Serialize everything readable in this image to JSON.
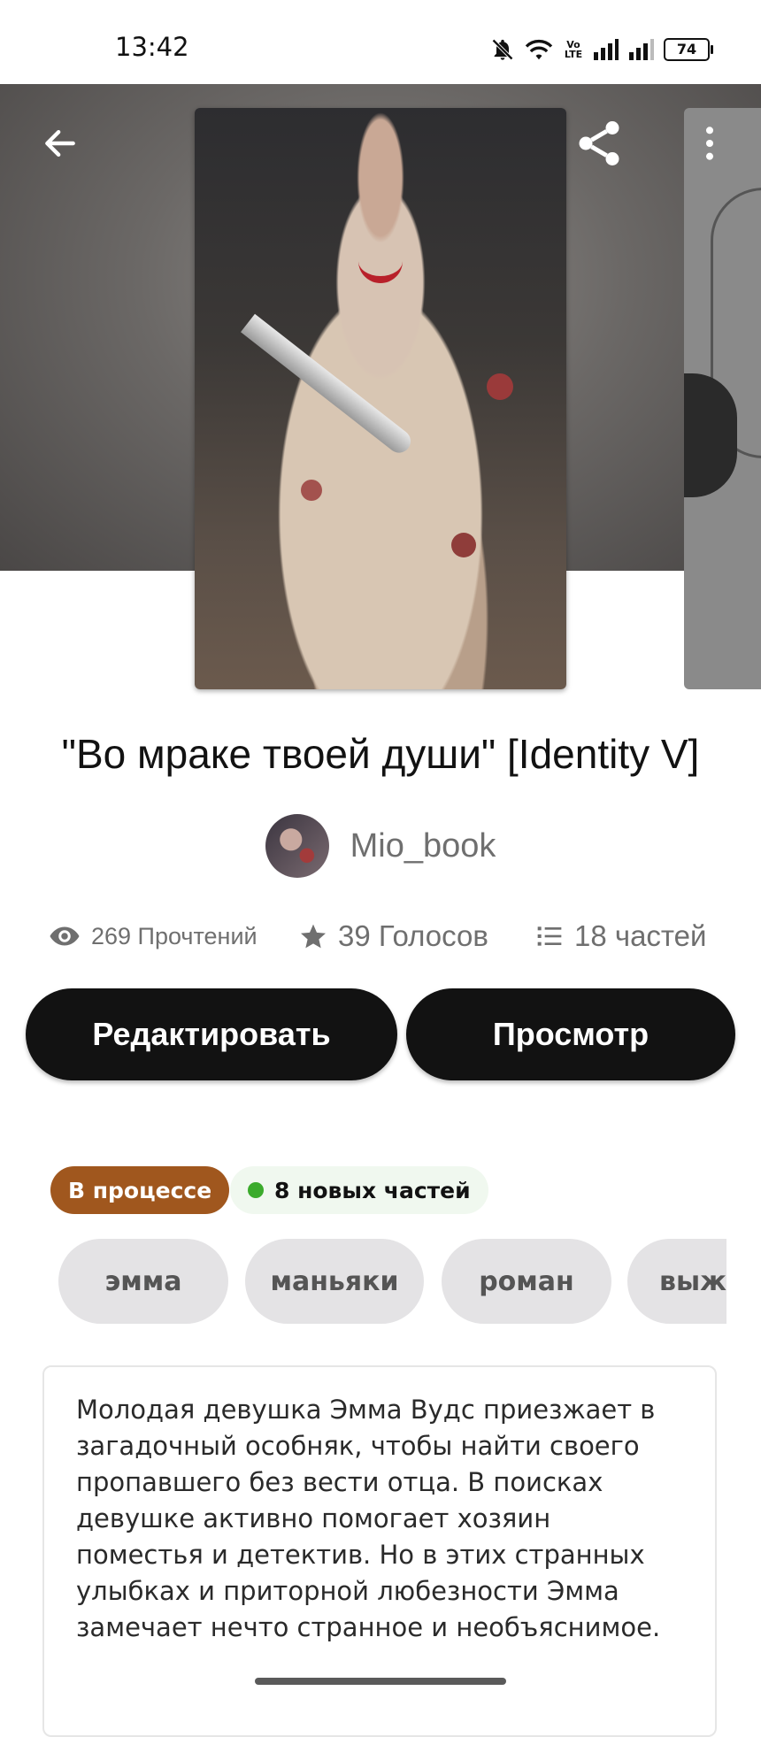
{
  "status_bar": {
    "time": "13:42",
    "volte": "Vo LTE",
    "battery": "74",
    "icons": [
      "bell-off-icon",
      "wifi-icon",
      "volte-icon",
      "signal-icon",
      "signal-icon",
      "battery-icon"
    ]
  },
  "header": {
    "back_icon": "arrow-left-icon",
    "share_icon": "share-icon",
    "more_icon": "more-vertical-icon"
  },
  "story": {
    "title": "\"Во мраке твоей души\" [Identity V]",
    "author": "Mio_book"
  },
  "stats": {
    "reads": "269 Прочтений",
    "votes": "39 Голосов",
    "parts": "18 частей"
  },
  "actions": {
    "edit_label": "Редактировать",
    "view_label": "Просмотр"
  },
  "badges": {
    "status": "В процессе",
    "new_parts": "8 новых частей"
  },
  "tags": [
    "эмма",
    "маньяки",
    "роман",
    "выжи"
  ],
  "description": "Молодая девушка Эмма Вудс приезжает в загадочный особняк, чтобы найти своего пропавшего без вести отца. В поисках девушке активно помогает хозяин поместья и детектив. Но в этих странных улыбках и приторной любезности Эмма замечает нечто странное и необъяснимое.",
  "colors": {
    "primary_button": "#121212",
    "status_badge": "#a0571e",
    "new_parts_dot": "#3bab2c",
    "tag_bg": "#e4e3e5"
  }
}
